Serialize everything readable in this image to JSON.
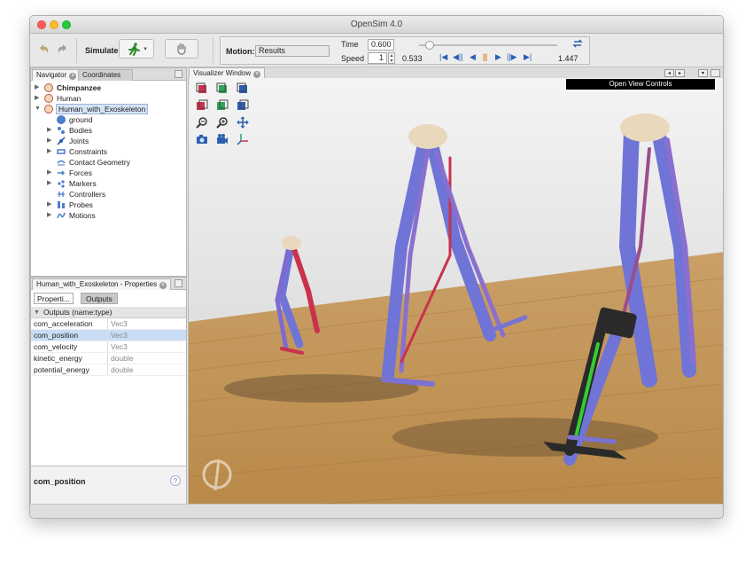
{
  "window": {
    "title": "OpenSim 4.0"
  },
  "toolbar": {
    "undo_icon": "undo-icon",
    "redo_icon": "redo-icon",
    "simulate_label": "Simulate",
    "run_icon": "running-man-icon",
    "hand_icon": "hand-icon",
    "motion_label": "Motion:",
    "motion_value": "Results",
    "time_label": "Time",
    "time_value": "0.600",
    "speed_label": "Speed",
    "speed_value": "1",
    "start_time": "0.533",
    "end_time": "1.447",
    "slider_position": 0.074,
    "loop_icon": "loop-icon"
  },
  "navigator": {
    "tabs": [
      {
        "label": "Navigator"
      },
      {
        "label": "Coordinates"
      }
    ],
    "items": [
      {
        "label": "Chimpanzee",
        "bold": true
      },
      {
        "label": "Human",
        "bold": true
      },
      {
        "label": "Human_with_Exoskeleton",
        "selected": true
      },
      {
        "label": "ground"
      },
      {
        "label": "Bodies"
      },
      {
        "label": "Joints"
      },
      {
        "label": "Constraints"
      },
      {
        "label": "Contact Geometry"
      },
      {
        "label": "Forces"
      },
      {
        "label": "Markers"
      },
      {
        "label": "Controllers"
      },
      {
        "label": "Probes"
      },
      {
        "label": "Motions"
      }
    ]
  },
  "properties": {
    "tab_label": "Human_with_Exoskeleton - Properties",
    "sub_tabs": [
      {
        "label": "Properti..."
      },
      {
        "label": "Outputs"
      }
    ],
    "section_header": "Outputs (name:type)",
    "rows": [
      {
        "name": "com_acceleration",
        "type": "Vec3"
      },
      {
        "name": "com_position",
        "type": "Vec3"
      },
      {
        "name": "com_velocity",
        "type": "Vec3"
      },
      {
        "name": "kinetic_energy",
        "type": "double"
      },
      {
        "name": "potential_energy",
        "type": "double"
      }
    ],
    "description_title": "com_position",
    "help_icon": "?"
  },
  "visualizer": {
    "tab_label": "Visualizer Window",
    "open_view_controls": "Open View Controls"
  },
  "colors": {
    "muscle_blue": "#6f74d6",
    "muscle_red": "#c8324c",
    "floor": "#c49a5a",
    "wall": "#d9d9d9",
    "exo_green": "#33cc33"
  }
}
